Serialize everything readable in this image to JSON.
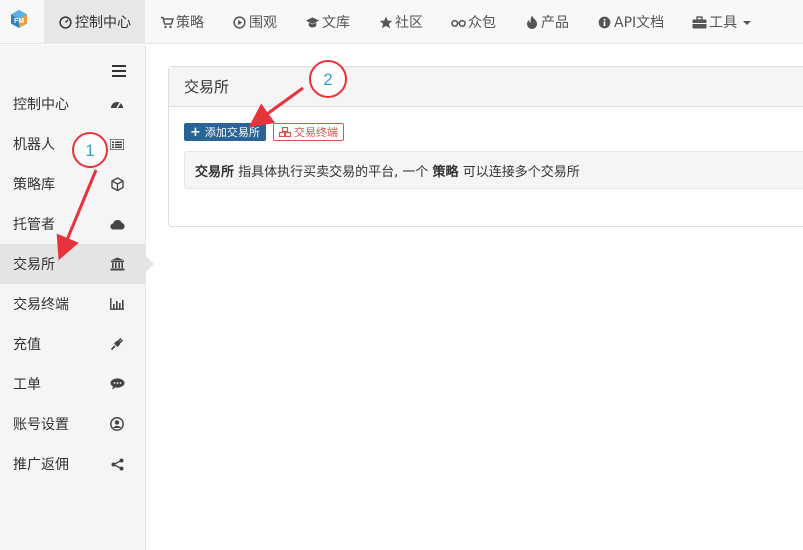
{
  "colors": {
    "accent_blue": "#2a6496",
    "danger_red": "#d9534f",
    "annotation_red": "#e8323c",
    "annotation_num": "#3aa0c8"
  },
  "topnav": {
    "items": [
      {
        "label": "控制中心",
        "icon": "dashboard-icon",
        "active": true
      },
      {
        "label": "策略",
        "icon": "cart-icon"
      },
      {
        "label": "围观",
        "icon": "play-circle-icon"
      },
      {
        "label": "文库",
        "icon": "graduation-cap-icon"
      },
      {
        "label": "社区",
        "icon": "star-icon"
      },
      {
        "label": "众包",
        "icon": "glasses-icon"
      },
      {
        "label": "产品",
        "icon": "fire-icon"
      },
      {
        "label": "API文档",
        "icon": "info-circle-icon"
      },
      {
        "label": "工具",
        "icon": "briefcase-icon",
        "dropdown": true
      }
    ]
  },
  "sidebar": {
    "items": [
      {
        "label": "控制中心",
        "icon": "tachometer-icon"
      },
      {
        "label": "机器人",
        "icon": "list-icon"
      },
      {
        "label": "策略库",
        "icon": "cube-icon"
      },
      {
        "label": "托管者",
        "icon": "cloud-icon"
      },
      {
        "label": "交易所",
        "icon": "bank-icon",
        "active": true
      },
      {
        "label": "交易终端",
        "icon": "bar-chart-icon"
      },
      {
        "label": "充值",
        "icon": "plug-icon"
      },
      {
        "label": "工单",
        "icon": "comment-icon"
      },
      {
        "label": "账号设置",
        "icon": "user-circle-icon"
      },
      {
        "label": "推广返佣",
        "icon": "share-icon"
      }
    ]
  },
  "panel": {
    "title": "交易所",
    "add_button": "添加交易所",
    "terminal_button": "交易终端",
    "desc_strong1": "交易所",
    "desc_text1": " 指具体执行买卖交易的平台, 一个 ",
    "desc_strong2": "策略",
    "desc_text2": " 可以连接多个交易所"
  },
  "annotations": {
    "step1": "1",
    "step2": "2"
  }
}
